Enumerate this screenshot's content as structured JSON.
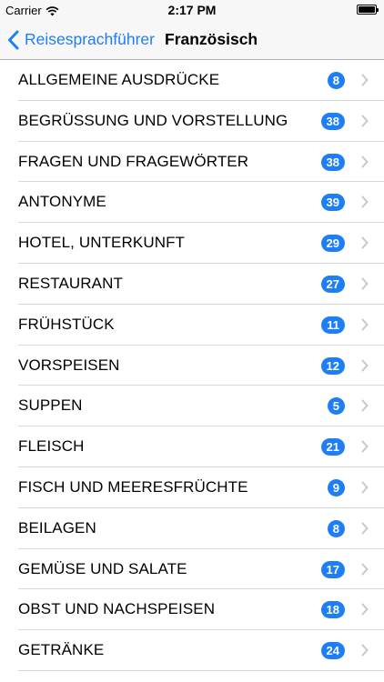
{
  "status_bar": {
    "carrier": "Carrier",
    "time": "2:17 PM",
    "wifi_icon": "wifi-icon",
    "battery_icon": "battery-icon"
  },
  "nav": {
    "back_label": "Reisesprachführer",
    "title": "Französisch",
    "back_icon": "chevron-left-icon"
  },
  "colors": {
    "accent": "#1e7ef5",
    "separator": "#d9d9dd",
    "chevron": "#c7c7cc"
  },
  "categories": [
    {
      "label": "ALLGEMEINE AUSDRÜCKE",
      "count": "8"
    },
    {
      "label": "BEGRÜSSUNG UND VORSTELLUNG",
      "count": "38"
    },
    {
      "label": "FRAGEN UND FRAGEWÖRTER",
      "count": "38"
    },
    {
      "label": "ANTONYME",
      "count": "39"
    },
    {
      "label": "HOTEL, UNTERKUNFT",
      "count": "29"
    },
    {
      "label": "RESTAURANT",
      "count": "27"
    },
    {
      "label": "FRÜHSTÜCK",
      "count": "11"
    },
    {
      "label": "VORSPEISEN",
      "count": "12"
    },
    {
      "label": "SUPPEN",
      "count": "5"
    },
    {
      "label": "FLEISCH",
      "count": "21"
    },
    {
      "label": "FISCH UND MEERESFRÜCHTE",
      "count": "9"
    },
    {
      "label": "BEILAGEN",
      "count": "8"
    },
    {
      "label": "GEMÜSE UND SALATE",
      "count": "17"
    },
    {
      "label": "OBST UND NACHSPEISEN",
      "count": "18"
    },
    {
      "label": "GETRÄNKE",
      "count": "24"
    }
  ]
}
